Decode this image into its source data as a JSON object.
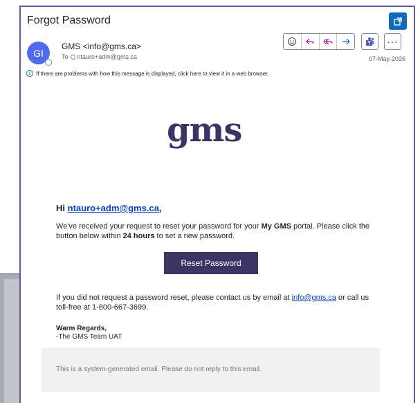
{
  "email": {
    "subject": "Forgot Password",
    "sender": {
      "initials": "GI",
      "display": "GMS <info@gms.ca>"
    },
    "to_label": "To",
    "recipient": "ntauro+adm@gms.ca",
    "date": "07-May-2026",
    "info_message": "If there are problems with how this message is displayed, click here to view it in a web browser."
  },
  "actions": {
    "icons": [
      "smiley-icon",
      "reply-icon",
      "reply-all-icon",
      "forward-icon",
      "teams-icon",
      "more-icon",
      "popout-icon"
    ],
    "more_label": "···"
  },
  "content": {
    "logo_text": "gms",
    "greeting_prefix": "Hi ",
    "greeting_email": "ntauro+adm@gms.ca",
    "greeting_suffix": ",",
    "para1_a": "We've received your request to reset your password for your ",
    "para1_bold1": "My GMS",
    "para1_b": " portal. Please click the button below within ",
    "para1_bold2": "24 hours",
    "para1_c": " to set a new password.",
    "button_label": "Reset Password",
    "para2_a": "If you did not request a password reset, please contact us by email at ",
    "para2_link": "info@gms.ca",
    "para2_b": " or call us toll-free at 1-800-667-3699.",
    "regards": "Warm Regards,",
    "team": "-The GMS Team UAT",
    "footer": "This is a system-generated email. Please do not reply to this email."
  },
  "colors": {
    "brand": "#3b3563",
    "accent": "#0f6cbd",
    "link": "#0f3fbf",
    "window_border": "#5b5aa6"
  }
}
